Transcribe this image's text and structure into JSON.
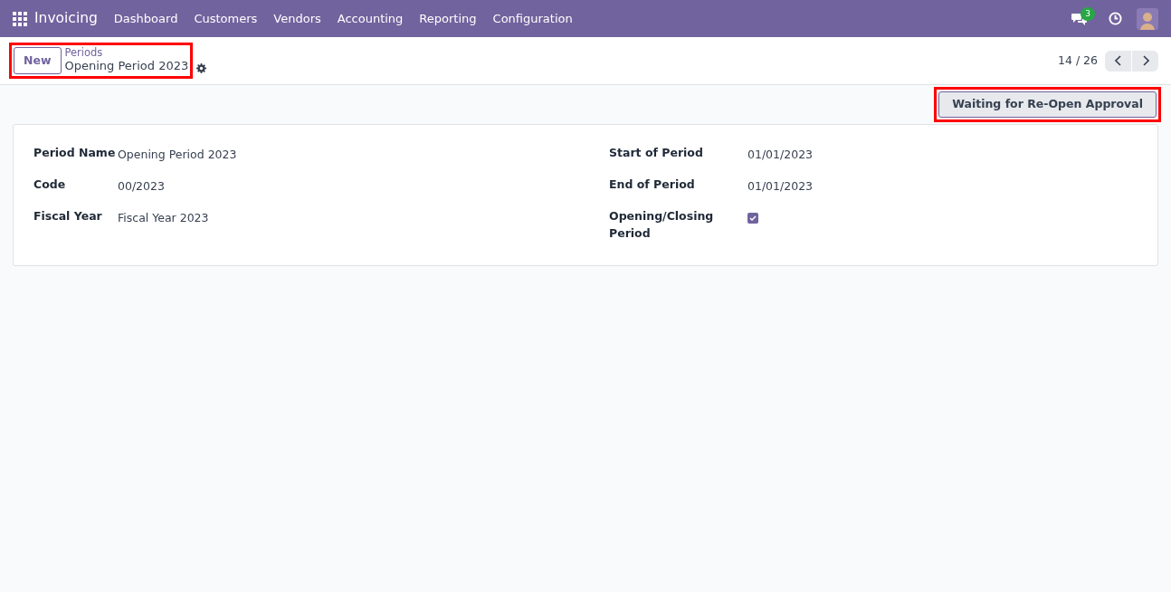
{
  "navbar": {
    "app_name": "Invoicing",
    "menu": [
      "Dashboard",
      "Customers",
      "Vendors",
      "Accounting",
      "Reporting",
      "Configuration"
    ],
    "messages_badge": "3"
  },
  "control_panel": {
    "new_button": "New",
    "breadcrumb": "Periods",
    "record_title": "Opening Period 2023",
    "pager": "14 / 26"
  },
  "status_button": "Waiting for Re-Open Approval",
  "form": {
    "left": [
      {
        "label": "Period Name",
        "kind": "text",
        "value": "Opening Period 2023"
      },
      {
        "label": "Code",
        "kind": "text",
        "value": "00/2023"
      },
      {
        "label": "Fiscal Year",
        "kind": "text",
        "value": "Fiscal Year 2023"
      }
    ],
    "right": [
      {
        "label": "Start of Period",
        "kind": "text",
        "value": "01/01/2023"
      },
      {
        "label": "End of Period",
        "kind": "text",
        "value": "01/01/2023"
      },
      {
        "label": "Opening/Closing Period",
        "kind": "checkbox",
        "checked": true
      }
    ]
  }
}
